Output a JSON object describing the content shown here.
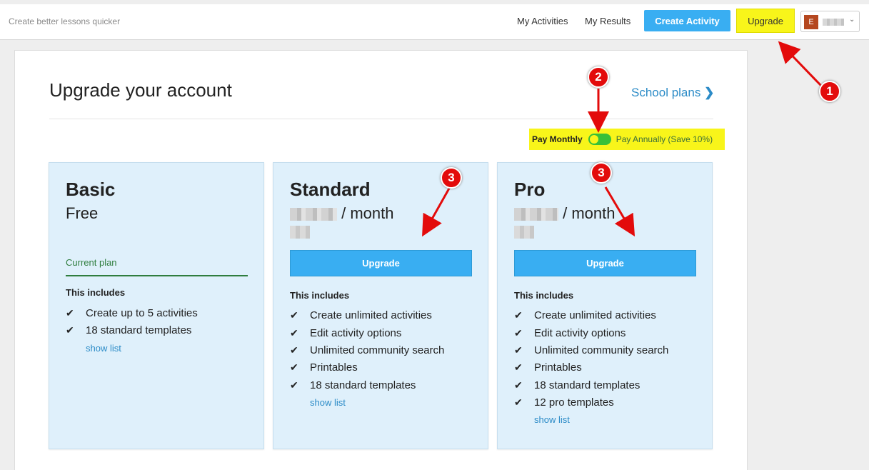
{
  "header": {
    "tagline": "Create better lessons quicker",
    "nav": [
      "My Activities",
      "My Results"
    ],
    "create_button": "Create Activity",
    "upgrade_button": "Upgrade",
    "avatar_initial": "E"
  },
  "page": {
    "title": "Upgrade your account",
    "school_plans": "School plans",
    "billing": {
      "monthly": "Pay Monthly",
      "annual": "Pay Annually (Save 10%)"
    }
  },
  "plans": [
    {
      "name": "Basic",
      "price": "Free",
      "status": "Current plan",
      "includes_label": "This includes",
      "features": [
        "Create up to 5 activities",
        "18 standard templates"
      ],
      "show_list": "show list"
    },
    {
      "name": "Standard",
      "price_suffix": "/ month",
      "button": "Upgrade",
      "includes_label": "This includes",
      "features": [
        "Create unlimited activities",
        "Edit activity options",
        "Unlimited community search",
        "Printables",
        "18 standard templates"
      ],
      "show_list": "show list"
    },
    {
      "name": "Pro",
      "price_suffix": "/ month",
      "button": "Upgrade",
      "includes_label": "This includes",
      "features": [
        "Create unlimited activities",
        "Edit activity options",
        "Unlimited community search",
        "Printables",
        "18 standard templates",
        "12 pro templates"
      ],
      "show_list": "show list"
    }
  ],
  "annotations": {
    "m1": "1",
    "m2": "2",
    "m3": "3"
  },
  "colors": {
    "accent": "#39aef2",
    "highlight": "#f8f51a",
    "marker": "#e30b0b",
    "plan_bg": "#dff0fb"
  }
}
